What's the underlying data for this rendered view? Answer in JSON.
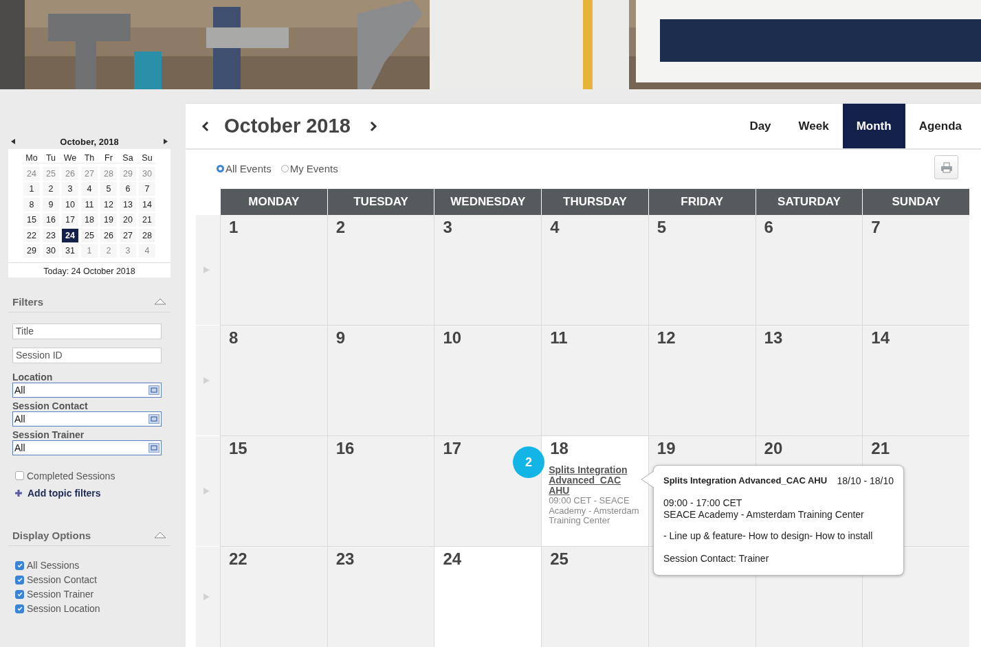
{
  "mini_calendar": {
    "title": "October, 2018",
    "weekdays": [
      "Mo",
      "Tu",
      "We",
      "Th",
      "Fr",
      "Sa",
      "Su"
    ],
    "weeks": [
      [
        {
          "day": "24",
          "muted": true,
          "selected": false
        },
        {
          "day": "25",
          "muted": true,
          "selected": false
        },
        {
          "day": "26",
          "muted": true,
          "selected": false
        },
        {
          "day": "27",
          "muted": true,
          "selected": false
        },
        {
          "day": "28",
          "muted": true,
          "selected": false
        },
        {
          "day": "29",
          "muted": true,
          "selected": false
        },
        {
          "day": "30",
          "muted": true,
          "selected": false
        }
      ],
      [
        {
          "day": "1",
          "muted": false,
          "selected": false
        },
        {
          "day": "2",
          "muted": false,
          "selected": false
        },
        {
          "day": "3",
          "muted": false,
          "selected": false
        },
        {
          "day": "4",
          "muted": false,
          "selected": false
        },
        {
          "day": "5",
          "muted": false,
          "selected": false
        },
        {
          "day": "6",
          "muted": false,
          "selected": false
        },
        {
          "day": "7",
          "muted": false,
          "selected": false
        }
      ],
      [
        {
          "day": "8",
          "muted": false,
          "selected": false
        },
        {
          "day": "9",
          "muted": false,
          "selected": false
        },
        {
          "day": "10",
          "muted": false,
          "selected": false
        },
        {
          "day": "11",
          "muted": false,
          "selected": false
        },
        {
          "day": "12",
          "muted": false,
          "selected": false
        },
        {
          "day": "13",
          "muted": false,
          "selected": false
        },
        {
          "day": "14",
          "muted": false,
          "selected": false
        }
      ],
      [
        {
          "day": "15",
          "muted": false,
          "selected": false
        },
        {
          "day": "16",
          "muted": false,
          "selected": false
        },
        {
          "day": "17",
          "muted": false,
          "selected": false
        },
        {
          "day": "18",
          "muted": false,
          "selected": false
        },
        {
          "day": "19",
          "muted": false,
          "selected": false
        },
        {
          "day": "20",
          "muted": false,
          "selected": false
        },
        {
          "day": "21",
          "muted": false,
          "selected": false
        }
      ],
      [
        {
          "day": "22",
          "muted": false,
          "selected": false
        },
        {
          "day": "23",
          "muted": false,
          "selected": false
        },
        {
          "day": "24",
          "muted": false,
          "selected": true
        },
        {
          "day": "25",
          "muted": false,
          "selected": false
        },
        {
          "day": "26",
          "muted": false,
          "selected": false
        },
        {
          "day": "27",
          "muted": false,
          "selected": false
        },
        {
          "day": "28",
          "muted": false,
          "selected": false
        }
      ],
      [
        {
          "day": "29",
          "muted": false,
          "selected": false
        },
        {
          "day": "30",
          "muted": false,
          "selected": false
        },
        {
          "day": "31",
          "muted": false,
          "selected": false
        },
        {
          "day": "1",
          "muted": true,
          "selected": false
        },
        {
          "day": "2",
          "muted": true,
          "selected": false
        },
        {
          "day": "3",
          "muted": true,
          "selected": false
        },
        {
          "day": "4",
          "muted": true,
          "selected": false
        }
      ]
    ],
    "today": "Today: 24 October 2018"
  },
  "filters": {
    "heading": "Filters",
    "expanded": true,
    "text_fields": [
      {
        "placeholder": "Title"
      },
      {
        "placeholder": "Session ID"
      }
    ],
    "selects": [
      {
        "label": "Location",
        "value": "All"
      },
      {
        "label": "Session Contact",
        "value": "All"
      },
      {
        "label": "Session Trainer",
        "value": "All"
      }
    ],
    "completed": {
      "label": "Completed Sessions",
      "checked": false
    },
    "add_link": "Add topic filters"
  },
  "display_options": {
    "heading": "Display Options",
    "expanded": true,
    "items": [
      {
        "label": "All Sessions",
        "checked": true
      },
      {
        "label": "Session Contact",
        "checked": true
      },
      {
        "label": "Session Trainer",
        "checked": true
      },
      {
        "label": "Session Location",
        "checked": true
      }
    ]
  },
  "calendar": {
    "title": "October 2018",
    "views": [
      {
        "label": "Day",
        "selected": false
      },
      {
        "label": "Week",
        "selected": false
      },
      {
        "label": "Month",
        "selected": true
      },
      {
        "label": "Agenda",
        "selected": false
      }
    ],
    "event_scope": [
      {
        "label": "All Events",
        "selected": true
      },
      {
        "label": "My Events",
        "selected": false
      }
    ],
    "columns": [
      "MONDAY",
      "TUESDAY",
      "WEDNESDAY",
      "THURSDAY",
      "FRIDAY",
      "SATURDAY",
      "SUNDAY"
    ],
    "weeks": [
      [
        {
          "number": "1",
          "highlighted": false
        },
        {
          "number": "2",
          "highlighted": false
        },
        {
          "number": "3",
          "highlighted": false
        },
        {
          "number": "4",
          "highlighted": false
        },
        {
          "number": "5",
          "highlighted": false
        },
        {
          "number": "6",
          "highlighted": false
        },
        {
          "number": "7",
          "highlighted": false
        }
      ],
      [
        {
          "number": "8",
          "highlighted": false
        },
        {
          "number": "9",
          "highlighted": false
        },
        {
          "number": "10",
          "highlighted": false
        },
        {
          "number": "11",
          "highlighted": false
        },
        {
          "number": "12",
          "highlighted": false
        },
        {
          "number": "13",
          "highlighted": false
        },
        {
          "number": "14",
          "highlighted": false
        }
      ],
      [
        {
          "number": "15",
          "highlighted": false
        },
        {
          "number": "16",
          "highlighted": false
        },
        {
          "number": "17",
          "highlighted": false
        },
        {
          "number": "18",
          "highlighted": true,
          "events": [
            {
              "title": "Splits Integration Advanced_CAC AHU",
              "detail": "09:00 CET - SEACE Academy - Amsterdam Training Center"
            }
          ]
        },
        {
          "number": "19",
          "highlighted": false
        },
        {
          "number": "20",
          "highlighted": false
        },
        {
          "number": "21",
          "highlighted": false
        }
      ],
      [
        {
          "number": "22",
          "highlighted": false
        },
        {
          "number": "23",
          "highlighted": false
        },
        {
          "number": "24",
          "highlighted": true
        },
        {
          "number": "25",
          "highlighted": false
        },
        {
          "highlighted": false
        },
        {
          "highlighted": false
        },
        {
          "highlighted": false
        }
      ]
    ],
    "badge": "2",
    "tooltip": {
      "title": "Splits Integration Advanced_CAC AHU",
      "dates": "18/10 - 18/10",
      "time": "09:00 - 17:00 CET",
      "location": "SEACE Academy - Amsterdam Training Center",
      "description": "- Line up & feature- How to design- How to install",
      "contact": "Session Contact: Trainer"
    }
  }
}
